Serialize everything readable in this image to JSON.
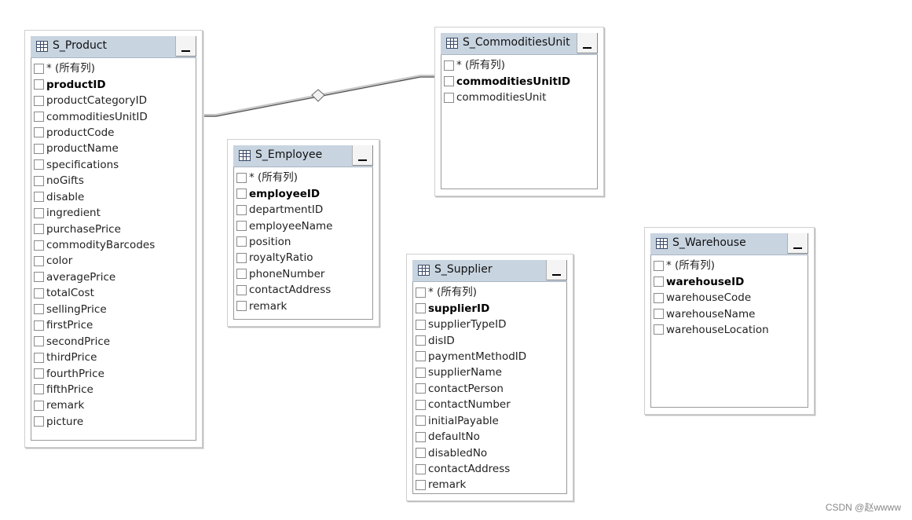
{
  "tables": [
    {
      "id": "s-product",
      "name": "S_Product",
      "columns": [
        "* (所有列)",
        "productID",
        "productCategoryID",
        "commoditiesUnitID",
        "productCode",
        "productName",
        "specifications",
        "noGifts",
        "disable",
        "ingredient",
        "purchasePrice",
        "commodityBarcodes",
        "color",
        "averagePrice",
        "totalCost",
        "sellingPrice",
        "firstPrice",
        "secondPrice",
        "thirdPrice",
        "fourthPrice",
        "fifthPrice",
        "remark",
        "picture"
      ],
      "primary_key": "productID"
    },
    {
      "id": "s-commoditiesunit",
      "name": "S_CommoditiesUnit",
      "columns": [
        "* (所有列)",
        "commoditiesUnitID",
        "commoditiesUnit"
      ],
      "primary_key": "commoditiesUnitID"
    },
    {
      "id": "s-employee",
      "name": "S_Employee",
      "columns": [
        "* (所有列)",
        "employeeID",
        "departmentID",
        "employeeName",
        "position",
        "royaltyRatio",
        "phoneNumber",
        "contactAddress",
        "remark"
      ],
      "primary_key": "employeeID"
    },
    {
      "id": "s-supplier",
      "name": "S_Supplier",
      "columns": [
        "* (所有列)",
        "supplierID",
        "supplierTypeID",
        "disID",
        "paymentMethodID",
        "supplierName",
        "contactPerson",
        "contactNumber",
        "initialPayable",
        "defaultNo",
        "disabledNo",
        "contactAddress",
        "remark"
      ],
      "primary_key": "supplierID"
    },
    {
      "id": "s-warehouse",
      "name": "S_Warehouse",
      "columns": [
        "* (所有列)",
        "warehouseID",
        "warehouseCode",
        "warehouseName",
        "warehouseLocation"
      ],
      "primary_key": "warehouseID"
    }
  ],
  "relationships": [
    {
      "from": "S_Product",
      "to": "S_CommoditiesUnit"
    }
  ],
  "icons": {
    "table": "table-icon",
    "minimize": "minimize-icon",
    "relationship": "diamond-icon"
  },
  "watermark": "CSDN @赵wwww"
}
